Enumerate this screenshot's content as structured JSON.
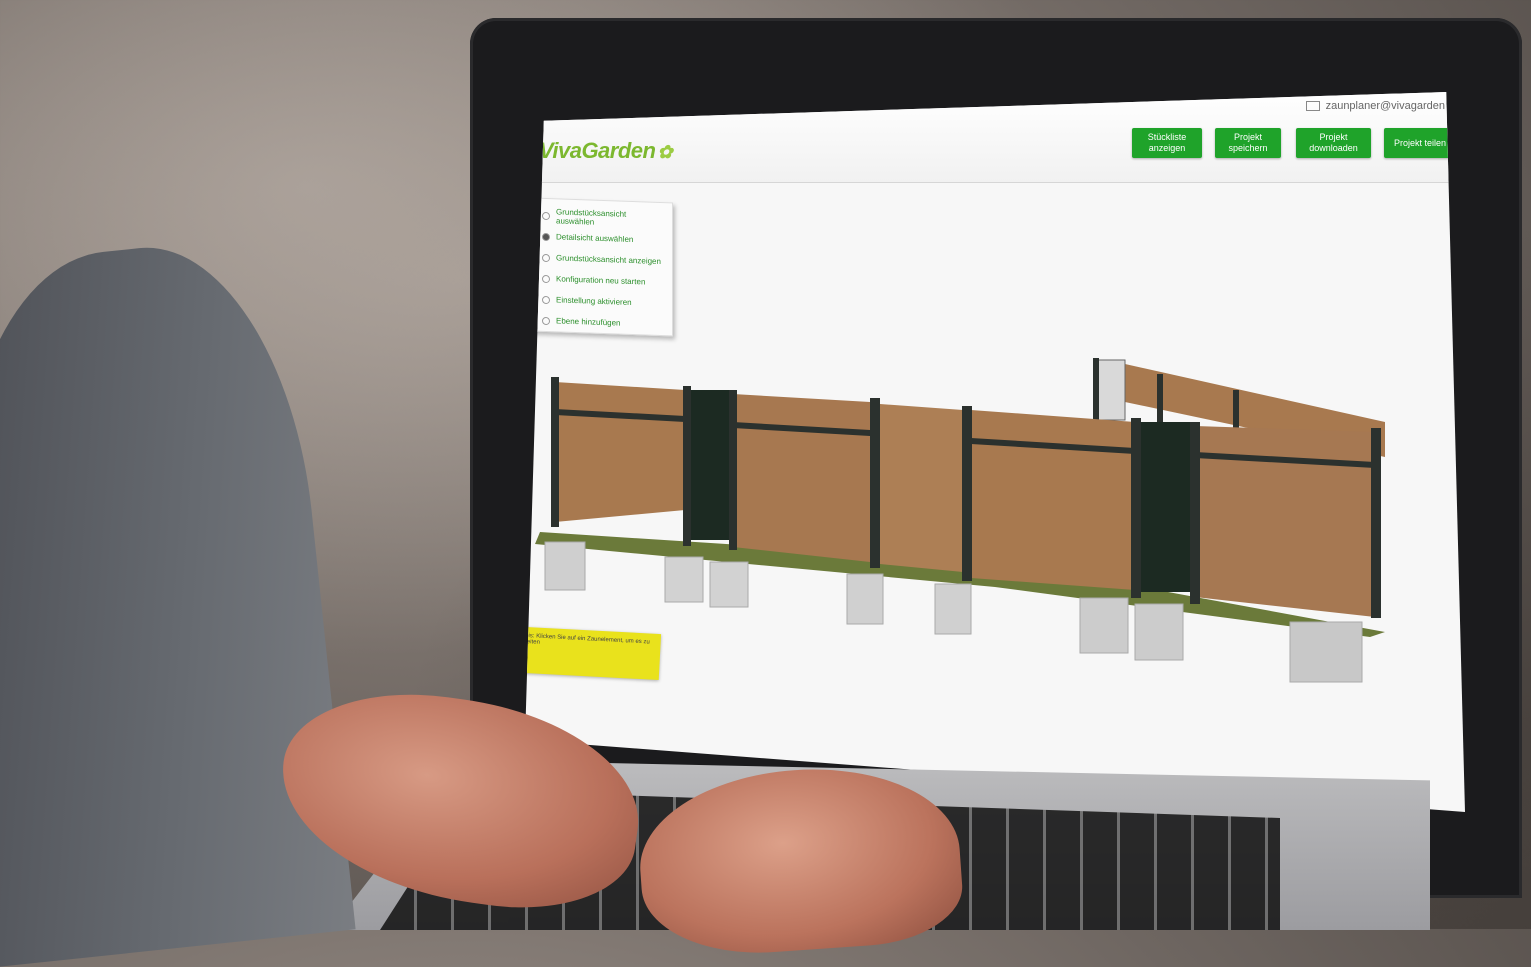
{
  "app": {
    "logo_text": "VivaGarden",
    "email": "zaunplaner@vivagarden"
  },
  "toolbar": {
    "buttons": [
      {
        "label": "Stückliste anzeigen"
      },
      {
        "label": "Projekt speichern"
      },
      {
        "label": "Projekt downloaden"
      },
      {
        "label": "Projekt teilen"
      }
    ]
  },
  "side_menu": {
    "items": [
      {
        "label": "Grundstücksansicht auswählen"
      },
      {
        "label": "Detailsicht auswählen"
      },
      {
        "label": "Grundstücksansicht anzeigen"
      },
      {
        "label": "Konfiguration neu starten"
      },
      {
        "label": "Einstellung aktivieren"
      },
      {
        "label": "Ebene hinzufügen"
      }
    ]
  },
  "hint": {
    "text": "Hinweis: Klicken Sie auf ein Zaunelement, um es zu bearbeiten"
  },
  "colors": {
    "accent_green": "#1fa32a",
    "logo_green": "#7cb82f",
    "hint_yellow": "#e9e21c",
    "wood": "#a8794f",
    "post": "#2b312e"
  },
  "icons": [
    "mail-icon",
    "leaf-icon"
  ]
}
